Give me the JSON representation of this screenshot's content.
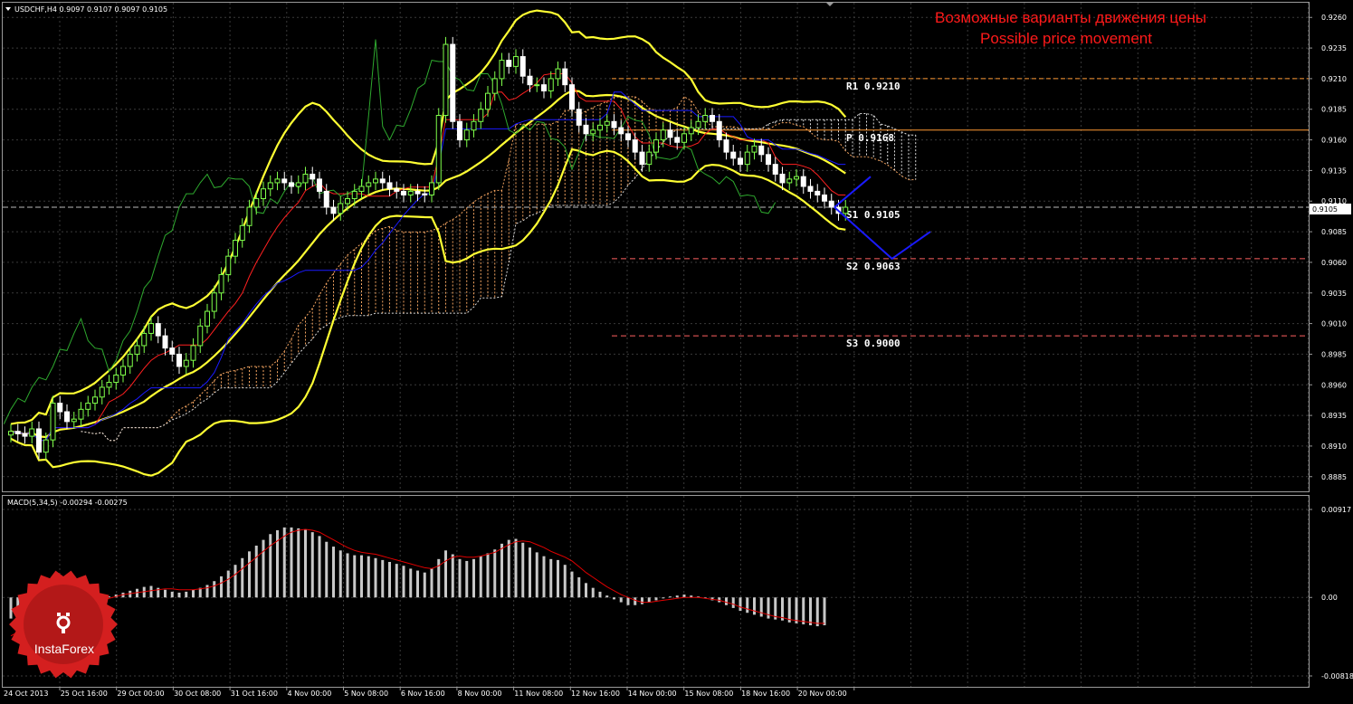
{
  "symbol_info": "USDCHF,H4  0.9097 0.9107 0.9097 0.9105",
  "annotation": {
    "line1": "Возможные варианты движения цены",
    "line2": "Possible price movement"
  },
  "current_price_badge": "0.9105",
  "macd": {
    "header": "MACD(5,34,5) -0.00294 -0.00275",
    "yticks": [
      "0.00917",
      "0.00",
      "-0.00818"
    ]
  },
  "logo": {
    "text": "InstaForex"
  },
  "colors": {
    "bg": "#000000",
    "grid": "#3a3a3a",
    "bull": "#7fff4a",
    "bear": "#ffffff",
    "bollinger": "#ffff33",
    "tenkan": "#ff2020",
    "kijun": "#1a1aff",
    "chikou": "#2ea82e",
    "cloud_a": "#f4a460",
    "cloud_b": "#dddddd",
    "pivot": "#ff9933",
    "support": "#ff6060",
    "forecast": "#1a1aff",
    "annotation": "#ff1a1a",
    "macd_hist": "#c8c8c8",
    "macd_signal": "#e00000",
    "logo_red": "#d41f1f"
  },
  "chart_data": [
    {
      "type": "candlestick",
      "title": "USDCHF,H4",
      "ylim": [
        0.8873,
        0.9272
      ],
      "y_ticks": [
        "0.9260",
        "0.9235",
        "0.9210",
        "0.9185",
        "0.9160",
        "0.9135",
        "0.9110",
        "0.9085",
        "0.9060",
        "0.9035",
        "0.9010",
        "0.8985",
        "0.8960",
        "0.8935",
        "0.8910",
        "0.8885"
      ],
      "x_tick_labels": [
        "24 Oct 2013",
        "25 Oct 16:00",
        "29 Oct 00:00",
        "30 Oct 08:00",
        "31 Oct 16:00",
        "4 Nov 00:00",
        "5 Nov 08:00",
        "6 Nov 16:00",
        "8 Nov 00:00",
        "11 Nov 08:00",
        "12 Nov 16:00",
        "14 Nov 00:00",
        "15 Nov 08:00",
        "18 Nov 16:00",
        "20 Nov 00:00"
      ],
      "close_series": [
        0.8922,
        0.892,
        0.8918,
        0.8924,
        0.8905,
        0.8915,
        0.8945,
        0.8938,
        0.893,
        0.8932,
        0.894,
        0.8945,
        0.895,
        0.8958,
        0.8962,
        0.8968,
        0.8975,
        0.8985,
        0.8992,
        0.9002,
        0.901,
        0.9,
        0.899,
        0.8985,
        0.8975,
        0.898,
        0.8992,
        0.9008,
        0.902,
        0.9035,
        0.905,
        0.9065,
        0.9078,
        0.909,
        0.9105,
        0.9112,
        0.912,
        0.9125,
        0.9128,
        0.9125,
        0.9122,
        0.9125,
        0.9132,
        0.9128,
        0.9118,
        0.9105,
        0.91,
        0.9108,
        0.9112,
        0.9118,
        0.9122,
        0.9125,
        0.9128,
        0.9125,
        0.912,
        0.9118,
        0.9115,
        0.9118,
        0.9116,
        0.9115,
        0.9125,
        0.918,
        0.9238,
        0.9175,
        0.916,
        0.9168,
        0.9175,
        0.9185,
        0.9198,
        0.921,
        0.9225,
        0.922,
        0.9228,
        0.9212,
        0.9205,
        0.9205,
        0.92,
        0.921,
        0.9218,
        0.9205,
        0.9185,
        0.9172,
        0.9165,
        0.9168,
        0.9172,
        0.9175,
        0.917,
        0.9165,
        0.916,
        0.915,
        0.914,
        0.915,
        0.916,
        0.9168,
        0.9162,
        0.9158,
        0.9165,
        0.917,
        0.9175,
        0.918,
        0.9175,
        0.916,
        0.915,
        0.9145,
        0.914,
        0.915,
        0.9155,
        0.9148,
        0.914,
        0.9132,
        0.9125,
        0.9128,
        0.913,
        0.9122,
        0.9118,
        0.9115,
        0.911,
        0.9105,
        0.91,
        0.9105
      ],
      "levels": [
        {
          "label": "R1  0.9210",
          "value": 0.921
        },
        {
          "label": "P  0.9168",
          "value": 0.9168
        },
        {
          "label": "S1  0.9105",
          "value": 0.9105
        },
        {
          "label": "S2  0.9063",
          "value": 0.9063
        },
        {
          "label": "S3  0.9000",
          "value": 0.9
        }
      ],
      "forecast_paths": [
        [
          [
            0.0,
            0.9105
          ],
          [
            1.0,
            0.913
          ]
        ],
        [
          [
            0.0,
            0.9105
          ],
          [
            0.6,
            0.9063
          ],
          [
            1.0,
            0.9085
          ]
        ]
      ],
      "indicators": [
        "Bollinger Bands",
        "Ichimoku",
        "Pivot levels"
      ]
    },
    {
      "type": "bar",
      "title": "MACD(5,34,5)",
      "ylim": [
        -0.00818,
        0.00917
      ],
      "histogram_last": -0.00294,
      "signal_last": -0.00275,
      "histogram": [
        -0.0022,
        -0.0023,
        -0.0024,
        -0.0023,
        -0.0021,
        -0.0018,
        -0.0015,
        -0.0013,
        -0.0011,
        -0.0009,
        -0.0006,
        -0.0004,
        -0.0002,
        0.0,
        0.0001,
        0.0003,
        0.0005,
        0.0007,
        0.0009,
        0.0011,
        0.0012,
        0.001,
        0.0008,
        0.0006,
        0.0005,
        0.0006,
        0.0008,
        0.001,
        0.0013,
        0.0017,
        0.0022,
        0.0028,
        0.0034,
        0.0041,
        0.0048,
        0.0054,
        0.006,
        0.0066,
        0.007,
        0.0073,
        0.0073,
        0.0072,
        0.0071,
        0.0068,
        0.0064,
        0.0058,
        0.0053,
        0.0049,
        0.0046,
        0.0044,
        0.0044,
        0.0043,
        0.0041,
        0.0039,
        0.0037,
        0.0035,
        0.0033,
        0.003,
        0.0028,
        0.0026,
        0.003,
        0.004,
        0.0049,
        0.0045,
        0.004,
        0.0038,
        0.004,
        0.0043,
        0.0046,
        0.005,
        0.0056,
        0.006,
        0.0061,
        0.0057,
        0.0052,
        0.0047,
        0.0043,
        0.004,
        0.0039,
        0.0034,
        0.0027,
        0.0021,
        0.0015,
        0.001,
        0.0006,
        0.0002,
        -0.0002,
        -0.0005,
        -0.0008,
        -0.0008,
        -0.0007,
        -0.0005,
        -0.0003,
        -0.0001,
        0.0001,
        0.0002,
        0.0003,
        0.0002,
        0.0001,
        -0.0001,
        -0.0003,
        -0.0005,
        -0.0008,
        -0.0011,
        -0.0014,
        -0.0016,
        -0.0018,
        -0.002,
        -0.0022,
        -0.0023,
        -0.0024,
        -0.0026,
        -0.0027,
        -0.0028,
        -0.0029,
        -0.003,
        -0.0029
      ],
      "signal": [
        -0.004,
        -0.0036,
        -0.0032,
        -0.0029,
        -0.0026,
        -0.0023,
        -0.002,
        -0.0017,
        -0.0014,
        -0.0011,
        -0.0009,
        -0.0007,
        -0.0005,
        -0.0003,
        -0.0001,
        0.0001,
        0.0003,
        0.0004,
        0.0005,
        0.0006,
        0.0007,
        0.0008,
        0.0009,
        0.0009,
        0.0008,
        0.0008,
        0.0008,
        0.0009,
        0.001,
        0.0012,
        0.0015,
        0.0019,
        0.0024,
        0.003,
        0.0036,
        0.0042,
        0.0048,
        0.0054,
        0.0059,
        0.0064,
        0.0068,
        0.007,
        0.0071,
        0.007,
        0.0068,
        0.0064,
        0.006,
        0.0056,
        0.0052,
        0.0049,
        0.0047,
        0.0046,
        0.0045,
        0.0043,
        0.0041,
        0.0039,
        0.0037,
        0.0035,
        0.0033,
        0.0031,
        0.003,
        0.0033,
        0.0038,
        0.0042,
        0.0043,
        0.0042,
        0.0042,
        0.0043,
        0.0045,
        0.0047,
        0.0051,
        0.0055,
        0.0058,
        0.0059,
        0.0058,
        0.0055,
        0.0052,
        0.0048,
        0.0045,
        0.0042,
        0.0038,
        0.0032,
        0.0026,
        0.0021,
        0.0016,
        0.0011,
        0.0007,
        0.0003,
        0.0,
        -0.0003,
        -0.0005,
        -0.0005,
        -0.0004,
        -0.0003,
        -0.0002,
        -0.0001,
        0.0,
        0.0,
        0.0,
        -0.0001,
        -0.0002,
        -0.0003,
        -0.0005,
        -0.0007,
        -0.001,
        -0.0012,
        -0.0014,
        -0.0016,
        -0.0018,
        -0.002,
        -0.0021,
        -0.0023,
        -0.0024,
        -0.0025,
        -0.0026,
        -0.0027,
        -0.0027
      ]
    }
  ]
}
